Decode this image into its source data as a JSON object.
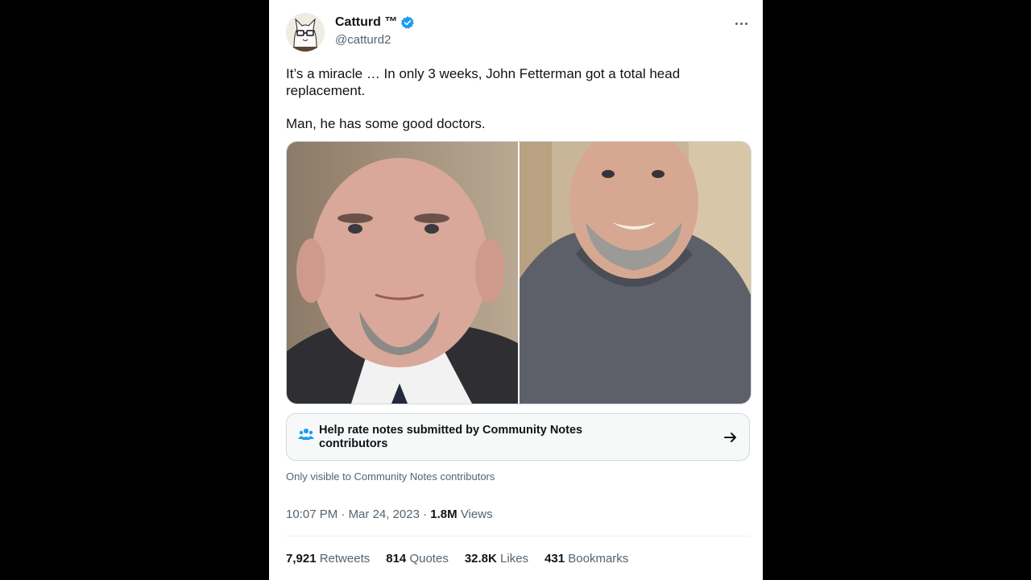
{
  "author": {
    "name": "Catturd ™",
    "handle": "@catturd2",
    "verified_color": "#1d9bf0"
  },
  "tweet": {
    "paragraphs": [
      "It’s a miracle … In only 3 weeks, John Fetterman got a total head replacement.",
      "Man, he has some good doctors."
    ]
  },
  "community_notes": {
    "label": "Help rate notes submitted by Community Notes contributors",
    "visibility": "Only visible to Community Notes contributors"
  },
  "meta": {
    "time": "10:07 PM",
    "separator1": "·",
    "date": "Mar 24, 2023",
    "separator2": "·",
    "views_count": "1.8M",
    "views_label": "Views"
  },
  "stats": {
    "retweets_count": "7,921",
    "retweets_label": "Retweets",
    "quotes_count": "814",
    "quotes_label": "Quotes",
    "likes_count": "32.8K",
    "likes_label": "Likes",
    "bookmarks_count": "431",
    "bookmarks_label": "Bookmarks"
  }
}
